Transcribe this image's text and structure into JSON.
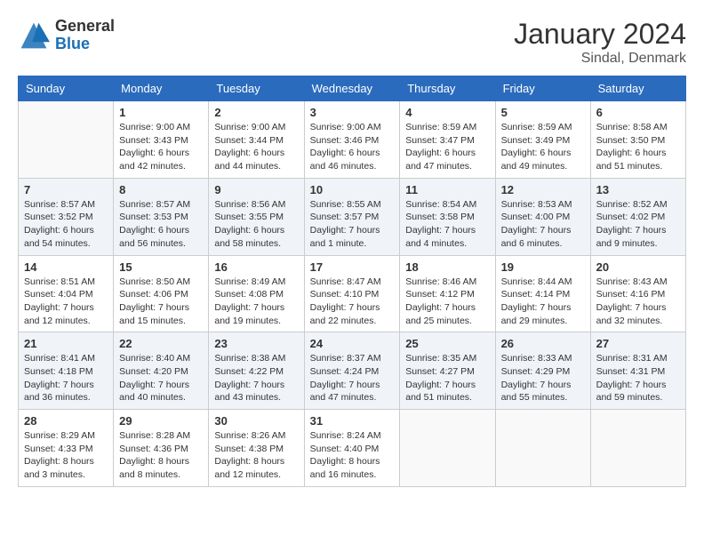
{
  "logo": {
    "general": "General",
    "blue": "Blue"
  },
  "title": "January 2024",
  "subtitle": "Sindal, Denmark",
  "days_header": [
    "Sunday",
    "Monday",
    "Tuesday",
    "Wednesday",
    "Thursday",
    "Friday",
    "Saturday"
  ],
  "weeks": [
    [
      {
        "day": "",
        "info": ""
      },
      {
        "day": "1",
        "info": "Sunrise: 9:00 AM\nSunset: 3:43 PM\nDaylight: 6 hours\nand 42 minutes."
      },
      {
        "day": "2",
        "info": "Sunrise: 9:00 AM\nSunset: 3:44 PM\nDaylight: 6 hours\nand 44 minutes."
      },
      {
        "day": "3",
        "info": "Sunrise: 9:00 AM\nSunset: 3:46 PM\nDaylight: 6 hours\nand 46 minutes."
      },
      {
        "day": "4",
        "info": "Sunrise: 8:59 AM\nSunset: 3:47 PM\nDaylight: 6 hours\nand 47 minutes."
      },
      {
        "day": "5",
        "info": "Sunrise: 8:59 AM\nSunset: 3:49 PM\nDaylight: 6 hours\nand 49 minutes."
      },
      {
        "day": "6",
        "info": "Sunrise: 8:58 AM\nSunset: 3:50 PM\nDaylight: 6 hours\nand 51 minutes."
      }
    ],
    [
      {
        "day": "7",
        "info": "Sunrise: 8:57 AM\nSunset: 3:52 PM\nDaylight: 6 hours\nand 54 minutes."
      },
      {
        "day": "8",
        "info": "Sunrise: 8:57 AM\nSunset: 3:53 PM\nDaylight: 6 hours\nand 56 minutes."
      },
      {
        "day": "9",
        "info": "Sunrise: 8:56 AM\nSunset: 3:55 PM\nDaylight: 6 hours\nand 58 minutes."
      },
      {
        "day": "10",
        "info": "Sunrise: 8:55 AM\nSunset: 3:57 PM\nDaylight: 7 hours\nand 1 minute."
      },
      {
        "day": "11",
        "info": "Sunrise: 8:54 AM\nSunset: 3:58 PM\nDaylight: 7 hours\nand 4 minutes."
      },
      {
        "day": "12",
        "info": "Sunrise: 8:53 AM\nSunset: 4:00 PM\nDaylight: 7 hours\nand 6 minutes."
      },
      {
        "day": "13",
        "info": "Sunrise: 8:52 AM\nSunset: 4:02 PM\nDaylight: 7 hours\nand 9 minutes."
      }
    ],
    [
      {
        "day": "14",
        "info": "Sunrise: 8:51 AM\nSunset: 4:04 PM\nDaylight: 7 hours\nand 12 minutes."
      },
      {
        "day": "15",
        "info": "Sunrise: 8:50 AM\nSunset: 4:06 PM\nDaylight: 7 hours\nand 15 minutes."
      },
      {
        "day": "16",
        "info": "Sunrise: 8:49 AM\nSunset: 4:08 PM\nDaylight: 7 hours\nand 19 minutes."
      },
      {
        "day": "17",
        "info": "Sunrise: 8:47 AM\nSunset: 4:10 PM\nDaylight: 7 hours\nand 22 minutes."
      },
      {
        "day": "18",
        "info": "Sunrise: 8:46 AM\nSunset: 4:12 PM\nDaylight: 7 hours\nand 25 minutes."
      },
      {
        "day": "19",
        "info": "Sunrise: 8:44 AM\nSunset: 4:14 PM\nDaylight: 7 hours\nand 29 minutes."
      },
      {
        "day": "20",
        "info": "Sunrise: 8:43 AM\nSunset: 4:16 PM\nDaylight: 7 hours\nand 32 minutes."
      }
    ],
    [
      {
        "day": "21",
        "info": "Sunrise: 8:41 AM\nSunset: 4:18 PM\nDaylight: 7 hours\nand 36 minutes."
      },
      {
        "day": "22",
        "info": "Sunrise: 8:40 AM\nSunset: 4:20 PM\nDaylight: 7 hours\nand 40 minutes."
      },
      {
        "day": "23",
        "info": "Sunrise: 8:38 AM\nSunset: 4:22 PM\nDaylight: 7 hours\nand 43 minutes."
      },
      {
        "day": "24",
        "info": "Sunrise: 8:37 AM\nSunset: 4:24 PM\nDaylight: 7 hours\nand 47 minutes."
      },
      {
        "day": "25",
        "info": "Sunrise: 8:35 AM\nSunset: 4:27 PM\nDaylight: 7 hours\nand 51 minutes."
      },
      {
        "day": "26",
        "info": "Sunrise: 8:33 AM\nSunset: 4:29 PM\nDaylight: 7 hours\nand 55 minutes."
      },
      {
        "day": "27",
        "info": "Sunrise: 8:31 AM\nSunset: 4:31 PM\nDaylight: 7 hours\nand 59 minutes."
      }
    ],
    [
      {
        "day": "28",
        "info": "Sunrise: 8:29 AM\nSunset: 4:33 PM\nDaylight: 8 hours\nand 3 minutes."
      },
      {
        "day": "29",
        "info": "Sunrise: 8:28 AM\nSunset: 4:36 PM\nDaylight: 8 hours\nand 8 minutes."
      },
      {
        "day": "30",
        "info": "Sunrise: 8:26 AM\nSunset: 4:38 PM\nDaylight: 8 hours\nand 12 minutes."
      },
      {
        "day": "31",
        "info": "Sunrise: 8:24 AM\nSunset: 4:40 PM\nDaylight: 8 hours\nand 16 minutes."
      },
      {
        "day": "",
        "info": ""
      },
      {
        "day": "",
        "info": ""
      },
      {
        "day": "",
        "info": ""
      }
    ]
  ]
}
